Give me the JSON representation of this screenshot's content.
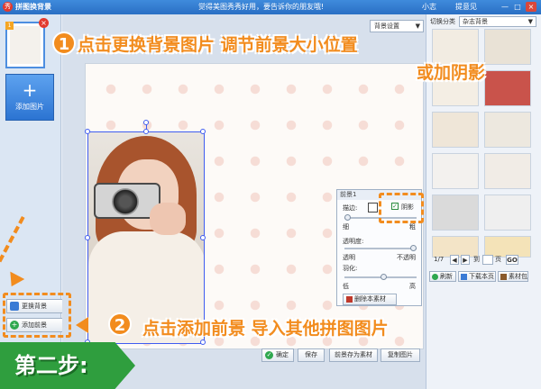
{
  "titlebar": {
    "app_title": "拼图换背景",
    "promo": "觉得美图秀秀好用，要告诉你的朋友哦!",
    "user": "小志",
    "feedback": "提意见",
    "min": "—",
    "max": "□",
    "close": "×"
  },
  "left_panel": {
    "thumb_index": "1",
    "add_picture": "添加图片",
    "change_background": "更换背景",
    "add_foreground": "添加前景"
  },
  "canvas": {
    "bg_settings": "背景设置"
  },
  "foreground_panel": {
    "title": "前景1",
    "stroke_label": "描边:",
    "shadow_label": "阴影",
    "shadow_checked": true,
    "thin": "细",
    "thick": "粗",
    "opacity_label": "透明度:",
    "transparent": "透明",
    "opaque": "不透明",
    "feather_label": "羽化:",
    "low": "低",
    "high": "高",
    "delete_button": "删除本素材"
  },
  "bottom_buttons": {
    "ok": "确定",
    "save": "保存",
    "save_foreground": "前景存为素材",
    "copy_image": "复制图片"
  },
  "right_panel": {
    "category_label": "切换分类",
    "category_value": "杂志背景",
    "page_current": "1/7",
    "page_to": "到",
    "page_unit": "页",
    "go": "GO",
    "refresh": "刷新",
    "download_page": "下载本页",
    "material_pack": "素材包"
  },
  "annotations": {
    "step1_num": "1",
    "step1_text": "点击更换背景图片 调节前景大小位置",
    "step1_text2": "或加阴影",
    "step2_num": "2",
    "step2_text": "点击添加前景 导入其他拼图图片",
    "step_badge": "第二步:"
  },
  "colors": {
    "accent_orange": "#f28c1e",
    "titlebar_blue": "#2a6fc4",
    "step_green": "#2f9e3e"
  }
}
